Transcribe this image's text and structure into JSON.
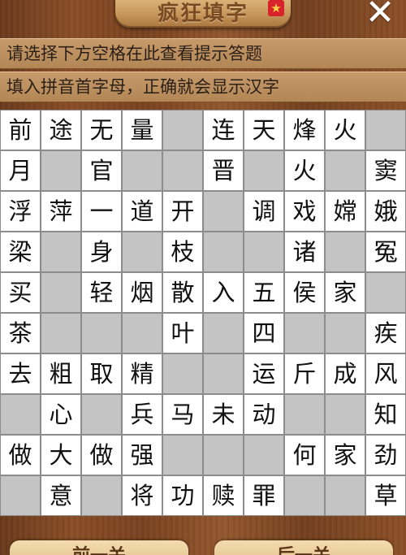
{
  "header": {
    "title": "疯狂填字",
    "badge": "★"
  },
  "hints": {
    "line1": "请选择下方空格在此查看提示答题",
    "line2": "填入拼音首字母，正确就会显示汉字"
  },
  "grid": {
    "rows": [
      [
        "前",
        "途",
        "无",
        "量",
        "",
        "连",
        "天",
        "烽",
        "火",
        ""
      ],
      [
        "月",
        "",
        "官",
        "",
        "",
        "晋",
        "",
        "火",
        "",
        "窦"
      ],
      [
        "浮",
        "萍",
        "一",
        "道",
        "开",
        "",
        "调",
        "戏",
        "嫦",
        "娥"
      ],
      [
        "梁",
        "",
        "身",
        "",
        "枝",
        "",
        "",
        "诸",
        "",
        "冤"
      ],
      [
        "买",
        "",
        "轻",
        "烟",
        "散",
        "入",
        "五",
        "侯",
        "家",
        ""
      ],
      [
        "茶",
        "",
        "",
        "",
        "叶",
        "",
        "四",
        "",
        "",
        "疾"
      ],
      [
        "去",
        "粗",
        "取",
        "精",
        "",
        "",
        "运",
        "斤",
        "成",
        "风"
      ],
      [
        "",
        "心",
        "",
        "兵",
        "马",
        "未",
        "动",
        "",
        "",
        "知"
      ],
      [
        "做",
        "大",
        "做",
        "强",
        "",
        "",
        "",
        "何",
        "家",
        "劲"
      ],
      [
        "",
        "意",
        "",
        "将",
        "功",
        "赎",
        "罪",
        "",
        "",
        "草"
      ]
    ]
  },
  "footer": {
    "prev_label": "前一关",
    "next_label": "后一关"
  }
}
